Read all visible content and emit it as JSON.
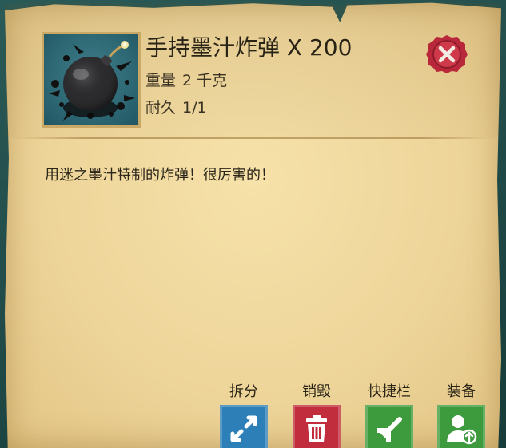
{
  "item": {
    "name": "手持墨汁炸弹 X 200",
    "icon": "ink-bomb-icon",
    "weight_label": "重量",
    "weight_value": "2 千克",
    "durability_label": "耐久",
    "durability_value": "1/1",
    "description": "用迷之墨汁特制的炸弹！很厉害的！"
  },
  "close": {
    "icon": "close-icon",
    "color": "#b8283a"
  },
  "actions": [
    {
      "label": "拆分",
      "icon": "split-arrows-icon",
      "color": "#2d7fb7"
    },
    {
      "label": "销毁",
      "icon": "trash-icon",
      "color": "#c22d3d"
    },
    {
      "label": "快捷栏",
      "icon": "hotbar-arrow-icon",
      "color": "#3d9a3d"
    },
    {
      "label": "装备",
      "icon": "equip-person-icon",
      "color": "#3d9a3d"
    }
  ],
  "colors": {
    "parchment": "#f2dca3",
    "text": "#2a2417",
    "background": "#1f4a48"
  }
}
